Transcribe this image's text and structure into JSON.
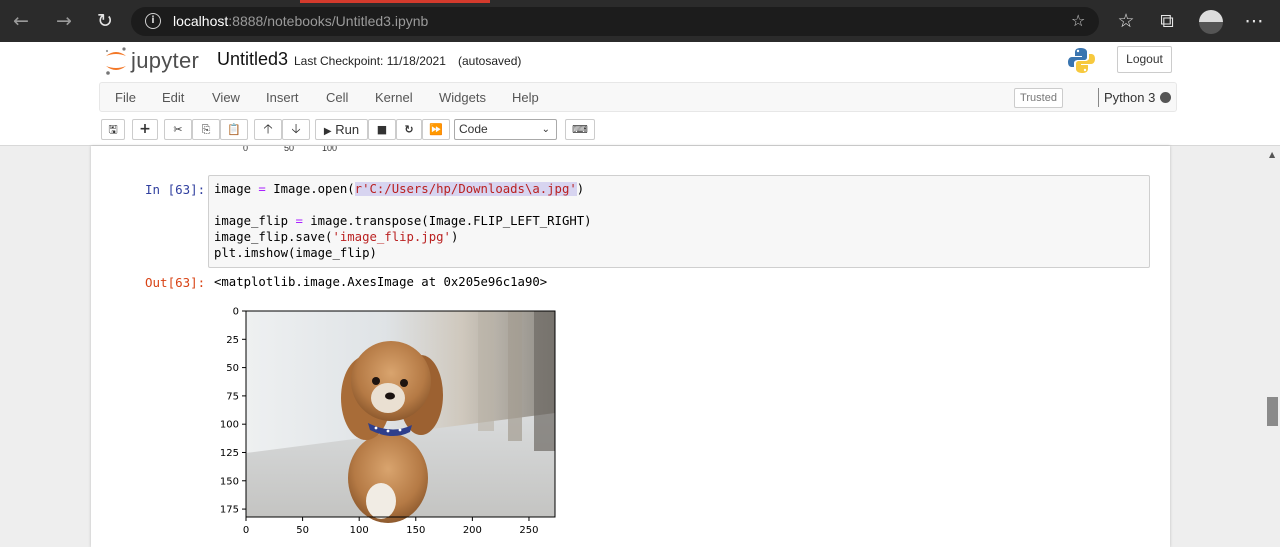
{
  "browser": {
    "url_host": "localhost",
    "url_path": ":8888/notebooks/Untitled3.ipynb"
  },
  "header": {
    "logo_text": "jupyter",
    "notebook_name": "Untitled3",
    "checkpoint": "Last Checkpoint: 11/18/2021",
    "autosave_status": "(autosaved)",
    "logout_label": "Logout"
  },
  "menu": {
    "items": [
      "File",
      "Edit",
      "View",
      "Insert",
      "Cell",
      "Kernel",
      "Widgets",
      "Help"
    ],
    "trusted_label": "Trusted",
    "kernel_name": "Python 3"
  },
  "toolbar": {
    "run_label": "Run",
    "cell_type": "Code"
  },
  "previous_output": {
    "ticks": [
      "0",
      "50",
      "100"
    ]
  },
  "cell": {
    "in_prompt": "In [63]:",
    "code": {
      "line1_pre": "image ",
      "line1_eq": "=",
      "line1_mid": " Image.open(",
      "line1_str": "r'C:/Users/hp/Downloads\\a.jpg'",
      "line1_end": ")",
      "line3_pre": "image_flip ",
      "line3_eq": "=",
      "line3_rest": " image.transpose(Image.FLIP_LEFT_RIGHT)",
      "line4_pre": "image_flip.save(",
      "line4_str": "'image_flip.jpg'",
      "line4_end": ")",
      "line5": "plt.imshow(image_flip)"
    },
    "out_prompt": "Out[63]:",
    "out_text": "<matplotlib.image.AxesImage at 0x205e96c1a90>"
  },
  "chart_data": {
    "type": "image",
    "image_subject": "photo of a fluffy light-brown dog with a blue patterned collar (flipped left-right)",
    "xlim": [
      0,
      273
    ],
    "ylim": [
      182,
      0
    ],
    "xticks": [
      "0",
      "50",
      "100",
      "150",
      "200",
      "250"
    ],
    "yticks": [
      "0",
      "25",
      "50",
      "75",
      "100",
      "125",
      "150",
      "175"
    ]
  },
  "colors": {
    "in_prompt": "#303f9f",
    "out_prompt": "#d84315",
    "string": "#ba2121",
    "operator": "#aa22ff"
  }
}
